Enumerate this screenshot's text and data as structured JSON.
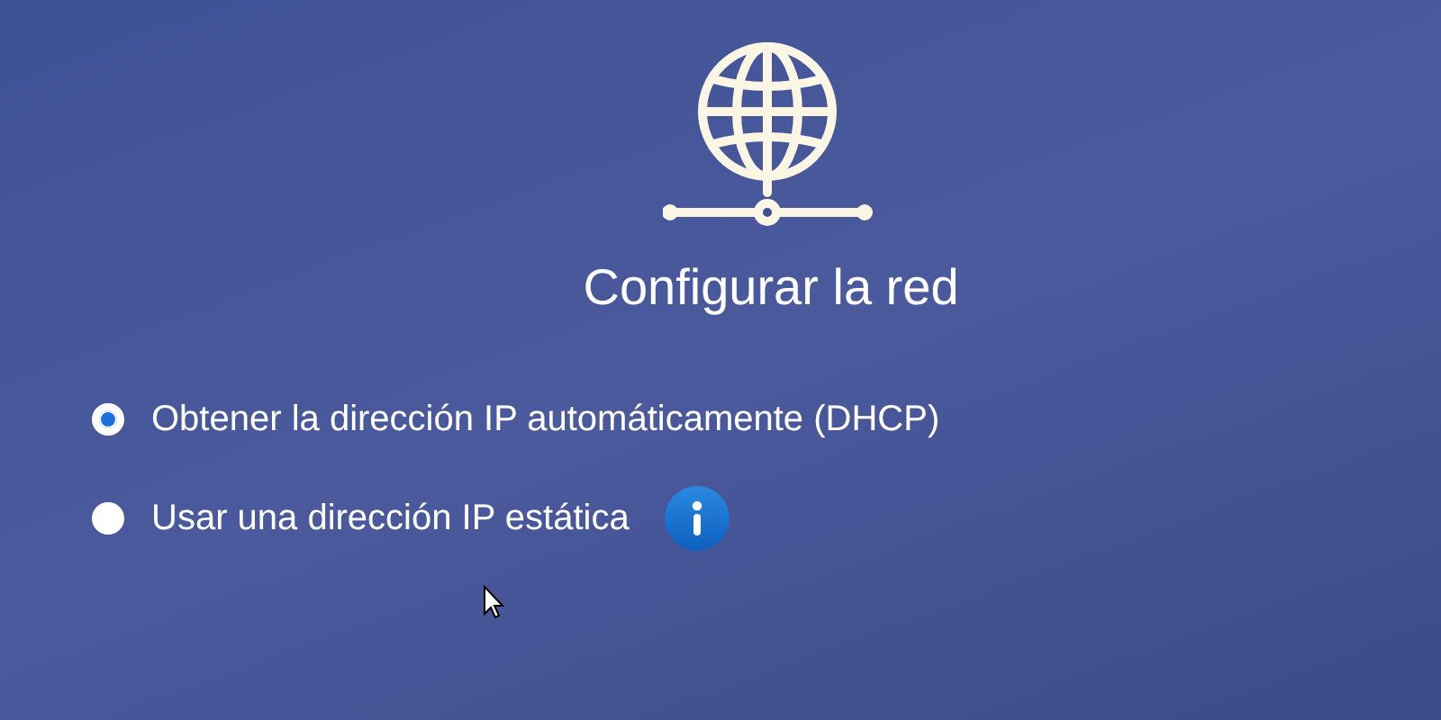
{
  "title": "Configurar la red",
  "options": [
    {
      "label": "Obtener la dirección IP automáticamente (DHCP)",
      "selected": true,
      "info": false
    },
    {
      "label": "Usar una dirección IP estática",
      "selected": false,
      "info": true
    }
  ]
}
